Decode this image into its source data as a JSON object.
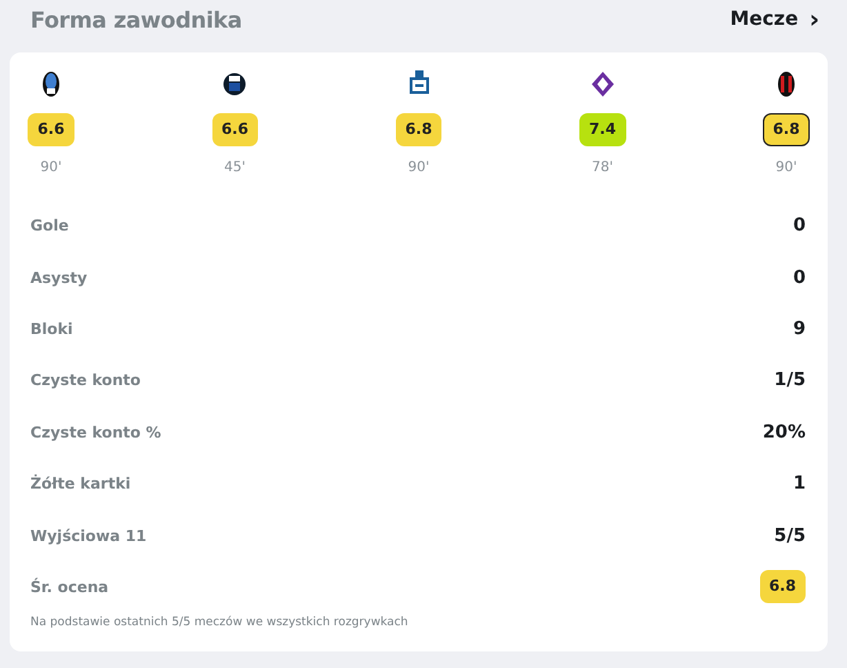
{
  "header": {
    "title": "Forma zawodnika",
    "link": "Mecze",
    "link_icon": "›"
  },
  "matches": [
    {
      "rating": "6.6",
      "color": "#f5d63d",
      "minutes": "90'",
      "selected": false,
      "crest": {
        "kind": "oval"
      }
    },
    {
      "rating": "6.6",
      "color": "#f5d63d",
      "minutes": "45'",
      "selected": false,
      "crest": {
        "kind": "round"
      }
    },
    {
      "rating": "6.8",
      "color": "#f5d63d",
      "minutes": "90'",
      "selected": false,
      "crest": {
        "kind": "cross"
      }
    },
    {
      "rating": "7.4",
      "color": "#b7e10f",
      "minutes": "78'",
      "selected": false,
      "crest": {
        "kind": "diamond"
      }
    },
    {
      "rating": "6.8",
      "color": "#f5d63d",
      "minutes": "90'",
      "selected": true,
      "crest": {
        "kind": "stripes"
      }
    }
  ],
  "stats": [
    {
      "label": "Gole",
      "value": "0",
      "kind": "text"
    },
    {
      "label": "Asysty",
      "value": "0",
      "kind": "text"
    },
    {
      "label": "Bloki",
      "value": "9",
      "kind": "text"
    },
    {
      "label": "Czyste konto",
      "value": "1/5",
      "kind": "text"
    },
    {
      "label": "Czyste konto %",
      "value": "20%",
      "kind": "text"
    },
    {
      "label": "Żółte kartki",
      "value": "1",
      "kind": "text"
    },
    {
      "label": "Wyjściowa 11",
      "value": "5/5",
      "kind": "text"
    },
    {
      "label": "Śr. ocena",
      "value": "6.8",
      "kind": "badge",
      "color": "#f5d63d"
    }
  ],
  "footnote": "Na podstawie ostatnich 5/5 meczów we wszystkich rozgrywkach"
}
